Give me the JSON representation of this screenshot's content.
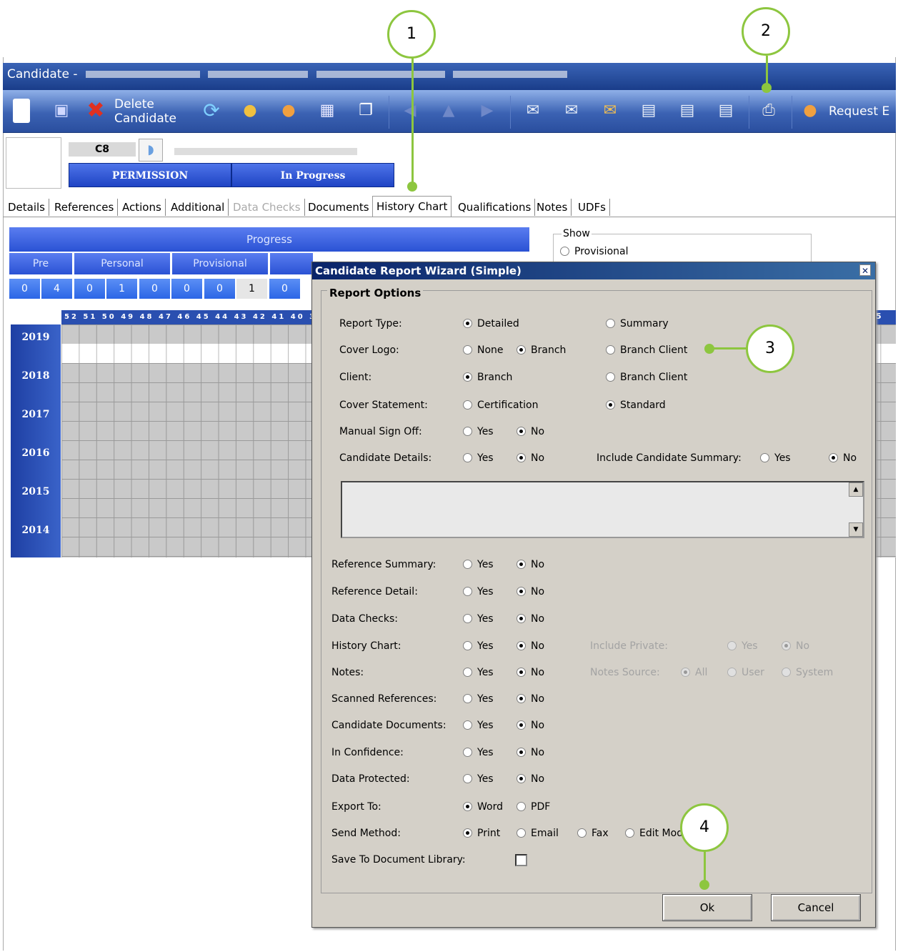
{
  "window": {
    "title": "Candidate -"
  },
  "toolbar": {
    "delete_label_1": "Delete",
    "delete_label_2": "Candidate",
    "request_label": "Request E"
  },
  "candidate": {
    "code": "C8",
    "status": [
      "PERMISSION",
      "In Progress"
    ]
  },
  "tabs": [
    "Details",
    "References",
    "Actions",
    "Additional",
    "Data Checks",
    "Documents",
    "History Chart",
    "Qualifications",
    "Notes",
    "UDFs"
  ],
  "active_tab": "History Chart",
  "progress": {
    "title": "Progress",
    "sections": [
      "Pre",
      "Personal",
      "Provisional"
    ],
    "counts": [
      "0",
      "4",
      "0",
      "1",
      "0",
      "0",
      "0",
      "1",
      "0"
    ]
  },
  "history": {
    "week_header": "52 51 50 49 48 47 46 45 44 43 42 41 40 39 3",
    "week_header_right": "5",
    "years": [
      "2019",
      "2018",
      "2017",
      "2016",
      "2015",
      "2014"
    ]
  },
  "show": {
    "legend": "Show",
    "provisional": "Provisional"
  },
  "dialog": {
    "title": "Candidate Report Wizard (Simple)",
    "close": "✕",
    "group_title": "Report Options",
    "report_type": {
      "label": "Report Type:",
      "options": [
        "Detailed",
        "Summary"
      ],
      "selected": "Detailed"
    },
    "cover_logo": {
      "label": "Cover Logo:",
      "options": [
        "None",
        "Branch",
        "Branch Client"
      ],
      "selected": "Branch"
    },
    "client": {
      "label": "Client:",
      "options": [
        "Branch",
        "Branch Client"
      ],
      "selected": "Branch"
    },
    "cover_statement": {
      "label": "Cover Statement:",
      "options": [
        "Certification",
        "Standard"
      ],
      "selected": "Standard"
    },
    "manual_sign_off": {
      "label": "Manual Sign Off:",
      "options": [
        "Yes",
        "No"
      ],
      "selected": "No"
    },
    "candidate_details": {
      "label": "Candidate Details:",
      "options": [
        "Yes",
        "No"
      ],
      "selected": "No"
    },
    "include_candidate_summary": {
      "label": "Include Candidate Summary:",
      "options": [
        "Yes",
        "No"
      ],
      "selected": "No"
    },
    "yes_no_rows": [
      {
        "label": "Reference Summary:",
        "selected": "No"
      },
      {
        "label": "Reference Detail:",
        "selected": "No"
      },
      {
        "label": "Data Checks:",
        "selected": "No"
      },
      {
        "label": "History Chart:",
        "selected": "No"
      },
      {
        "label": "Notes:",
        "selected": "No"
      },
      {
        "label": "Scanned References:",
        "selected": "No"
      },
      {
        "label": "Candidate Documents:",
        "selected": "No"
      },
      {
        "label": "In Confidence:",
        "selected": "No"
      },
      {
        "label": "Data Protected:",
        "selected": "No"
      }
    ],
    "yes": "Yes",
    "no": "No",
    "include_private": {
      "label": "Include Private:",
      "options": [
        "Yes",
        "No"
      ],
      "selected": "No"
    },
    "notes_source": {
      "label": "Notes Source:",
      "options": [
        "All",
        "User",
        "System"
      ],
      "selected": "All"
    },
    "export_to": {
      "label": "Export To:",
      "options": [
        "Word",
        "PDF"
      ],
      "selected": "Word"
    },
    "send_method": {
      "label": "Send Method:",
      "options": [
        "Print",
        "Email",
        "Fax",
        "Edit Mod"
      ],
      "selected": "Print"
    },
    "save_to_library": {
      "label": "Save To Document Library:",
      "checked": false
    },
    "ok": "Ok",
    "cancel": "Cancel"
  },
  "callouts": [
    "1",
    "2",
    "3",
    "4"
  ],
  "colors": {
    "callout": "#8dc63f",
    "titlebar": "#1a3d8a",
    "dialog_title": "#0a246a",
    "status_bar": "#2a52d4"
  }
}
